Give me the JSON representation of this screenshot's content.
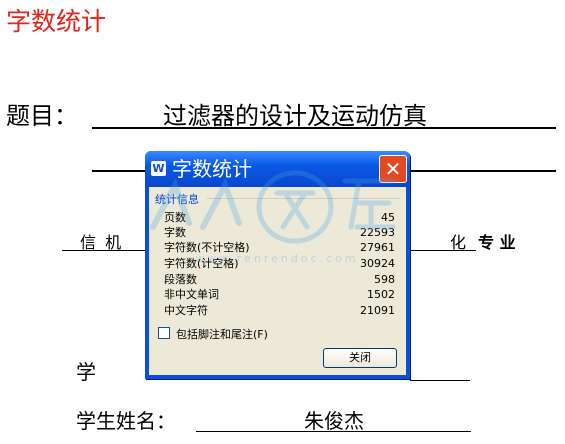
{
  "doc": {
    "title": "字数统计",
    "topic_label": "题目：",
    "topic_value": "过滤器的设计及运动仿真",
    "major_left": "信 机",
    "major_right": "化",
    "major_suffix": "专 业",
    "row_xue": "学",
    "student_label": "学生姓名：",
    "student_value": "朱俊杰"
  },
  "dialog": {
    "title": "字数统计",
    "app_icon": "W",
    "close_glyph": "✕",
    "group_title": "统计信息",
    "stats": [
      {
        "label": "页数",
        "value": "45"
      },
      {
        "label": "字数",
        "value": "22593"
      },
      {
        "label": "字符数(不计空格)",
        "value": "27961"
      },
      {
        "label": "字符数(计空格)",
        "value": "30924"
      },
      {
        "label": "段落数",
        "value": "598"
      },
      {
        "label": "非中文单词",
        "value": "1502"
      },
      {
        "label": "中文字符",
        "value": "21091"
      }
    ],
    "checkbox_label": "包括脚注和尾注(F)",
    "checkbox_checked": false,
    "close_button": "关闭"
  },
  "watermark": {
    "text": "人人文库",
    "url": "www.renrendoc.com"
  },
  "colors": {
    "title_red": "#e5231b",
    "xp_blue": "#0a4fd6",
    "dialog_face": "#ece9d8",
    "close_red": "#e24a22"
  }
}
